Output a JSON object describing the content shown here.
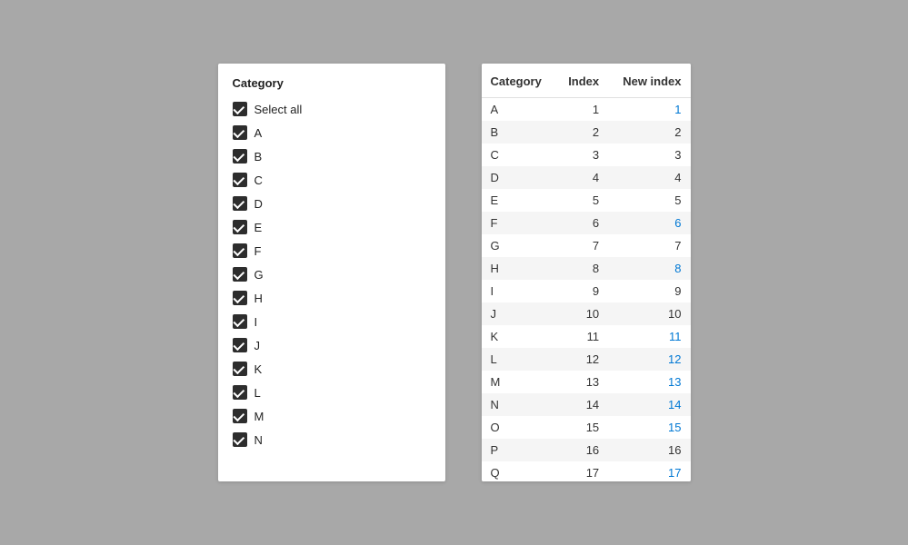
{
  "left_panel": {
    "header": "Category",
    "select_all_label": "Select all",
    "items": [
      {
        "label": "A",
        "checked": true
      },
      {
        "label": "B",
        "checked": true
      },
      {
        "label": "C",
        "checked": true
      },
      {
        "label": "D",
        "checked": true
      },
      {
        "label": "E",
        "checked": true
      },
      {
        "label": "F",
        "checked": true
      },
      {
        "label": "G",
        "checked": true
      },
      {
        "label": "H",
        "checked": true
      },
      {
        "label": "I",
        "checked": true
      },
      {
        "label": "J",
        "checked": true
      },
      {
        "label": "K",
        "checked": true
      },
      {
        "label": "L",
        "checked": true
      },
      {
        "label": "M",
        "checked": true
      },
      {
        "label": "N",
        "checked": true
      }
    ]
  },
  "right_panel": {
    "columns": [
      "Category",
      "Index",
      "New index"
    ],
    "rows": [
      {
        "category": "A",
        "index": 1,
        "new_index": 1,
        "highlight_new": true
      },
      {
        "category": "B",
        "index": 2,
        "new_index": 2,
        "highlight_new": false
      },
      {
        "category": "C",
        "index": 3,
        "new_index": 3,
        "highlight_new": false
      },
      {
        "category": "D",
        "index": 4,
        "new_index": 4,
        "highlight_new": false
      },
      {
        "category": "E",
        "index": 5,
        "new_index": 5,
        "highlight_new": false
      },
      {
        "category": "F",
        "index": 6,
        "new_index": 6,
        "highlight_new": true
      },
      {
        "category": "G",
        "index": 7,
        "new_index": 7,
        "highlight_new": false
      },
      {
        "category": "H",
        "index": 8,
        "new_index": 8,
        "highlight_new": true
      },
      {
        "category": "I",
        "index": 9,
        "new_index": 9,
        "highlight_new": false
      },
      {
        "category": "J",
        "index": 10,
        "new_index": 10,
        "highlight_new": false
      },
      {
        "category": "K",
        "index": 11,
        "new_index": 11,
        "highlight_new": true
      },
      {
        "category": "L",
        "index": 12,
        "new_index": 12,
        "highlight_new": true
      },
      {
        "category": "M",
        "index": 13,
        "new_index": 13,
        "highlight_new": true
      },
      {
        "category": "N",
        "index": 14,
        "new_index": 14,
        "highlight_new": true
      },
      {
        "category": "O",
        "index": 15,
        "new_index": 15,
        "highlight_new": true
      },
      {
        "category": "P",
        "index": 16,
        "new_index": 16,
        "highlight_new": false
      },
      {
        "category": "Q",
        "index": 17,
        "new_index": 17,
        "highlight_new": true
      }
    ]
  }
}
